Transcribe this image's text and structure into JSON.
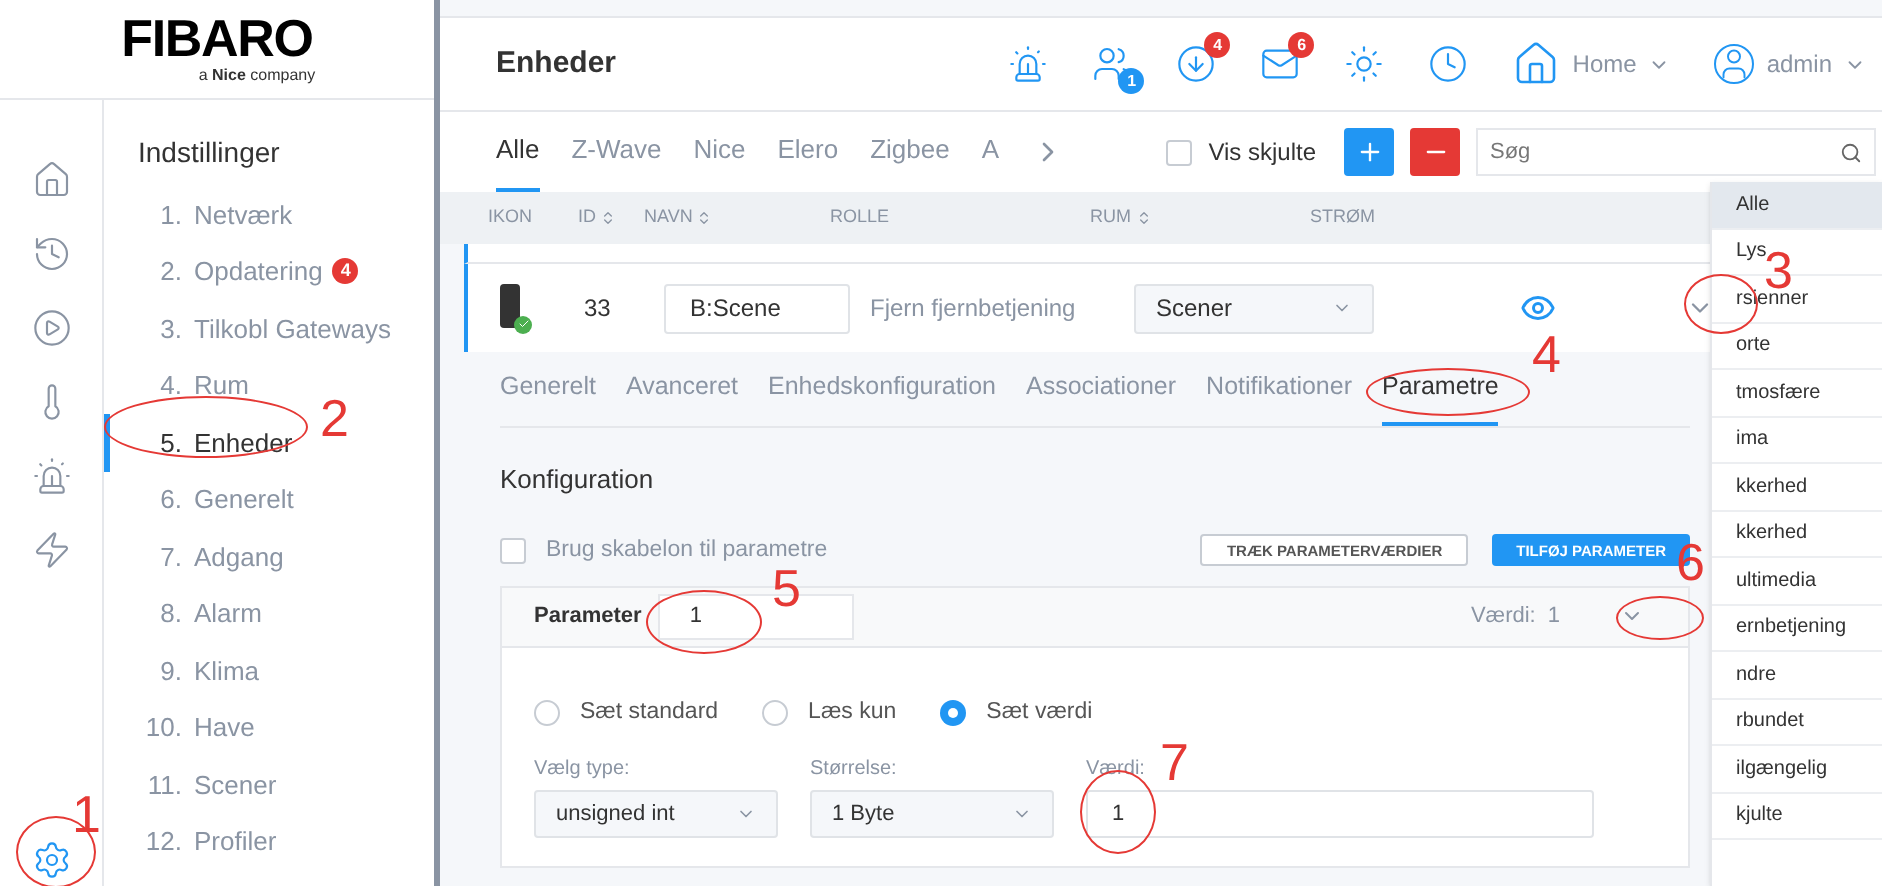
{
  "logo": {
    "brand": "FIBARO",
    "tagline": "a **Nice** company"
  },
  "rail": [
    {
      "kind": "home",
      "selected": false
    },
    {
      "kind": "history",
      "selected": false
    },
    {
      "kind": "play",
      "selected": false
    },
    {
      "kind": "thermometer",
      "selected": false
    },
    {
      "kind": "alarm",
      "selected": false
    },
    {
      "kind": "bolt",
      "selected": false
    },
    {
      "kind": "settings",
      "selected": true
    }
  ],
  "nav": {
    "title": "Indstillinger",
    "items": [
      {
        "number": "1.",
        "label": "Netværk",
        "selected": false
      },
      {
        "number": "2.",
        "label": "Opdatering",
        "selected": false,
        "badge": "4"
      },
      {
        "number": "3.",
        "label": "Tilkobl Gateways",
        "selected": false
      },
      {
        "number": "4.",
        "label": "Rum",
        "selected": false
      },
      {
        "number": "5.",
        "label": "Enheder",
        "selected": true
      },
      {
        "number": "6.",
        "label": "Generelt",
        "selected": false
      },
      {
        "number": "7.",
        "label": "Adgang",
        "selected": false
      },
      {
        "number": "8.",
        "label": "Alarm",
        "selected": false
      },
      {
        "number": "9.",
        "label": "Klima",
        "selected": false
      },
      {
        "number": "10.",
        "label": "Have",
        "selected": false
      },
      {
        "number": "11.",
        "label": "Scener",
        "selected": false
      },
      {
        "number": "12.",
        "label": "Profiler",
        "selected": false
      }
    ]
  },
  "header": {
    "title": "Enheder",
    "icons": [
      {
        "kind": "alarm"
      },
      {
        "kind": "users",
        "badge": "1",
        "color": "#2196f3"
      },
      {
        "kind": "download",
        "badge": "4",
        "color": "#e53935"
      },
      {
        "kind": "mail",
        "badge": "6",
        "color": "#e53935"
      },
      {
        "kind": "sun"
      },
      {
        "kind": "clock"
      }
    ],
    "home": "Home",
    "user": "admin"
  },
  "filter_tabs": [
    {
      "label": "Alle",
      "selected": true
    },
    {
      "label": "Z-Wave",
      "selected": false
    },
    {
      "label": "Nice",
      "selected": false
    },
    {
      "label": "Elero",
      "selected": false
    },
    {
      "label": "Zigbee",
      "selected": false
    },
    {
      "label": "A",
      "selected": false
    }
  ],
  "show_hidden": {
    "label": "Vis skjulte",
    "checked": false
  },
  "search": {
    "placeholder": "Søg"
  },
  "table": {
    "columns": [
      {
        "label": "IKON",
        "sortable": false
      },
      {
        "label": "ID",
        "sortable": true
      },
      {
        "label": "NAVN",
        "sortable": true
      },
      {
        "label": "ROLLE",
        "sortable": false
      },
      {
        "label": "RUM",
        "sortable": true
      },
      {
        "label": "STRØM",
        "sortable": false
      }
    ],
    "row": {
      "id": "33",
      "name": "B:Scene",
      "role": "Fjern fjernbetjening",
      "room": "Scener",
      "expanded": true
    }
  },
  "sub_tabs": [
    {
      "label": "Generelt",
      "selected": false
    },
    {
      "label": "Avanceret",
      "selected": false
    },
    {
      "label": "Enhedskonfiguration",
      "selected": false
    },
    {
      "label": "Associationer",
      "selected": false
    },
    {
      "label": "Notifikationer",
      "selected": false
    },
    {
      "label": "Parametre",
      "selected": true
    }
  ],
  "config": {
    "title": "Konfiguration",
    "template": {
      "label": "Brug skabelon til parametre",
      "checked": false
    },
    "buttons": [
      {
        "label": "TRÆK PARAMETERVÆRDIER",
        "kind": "secondary"
      },
      {
        "label": "TILFØJ PARAMETER",
        "kind": "primary"
      }
    ]
  },
  "parameter": {
    "label": "Parameter",
    "value": "1",
    "value_label": "Værdi:",
    "value_text": "1",
    "expanded": true,
    "radios": [
      {
        "label": "Sæt standard",
        "selected": false
      },
      {
        "label": "Læs kun",
        "selected": false
      },
      {
        "label": "Sæt værdi",
        "selected": true
      }
    ],
    "fields": [
      {
        "kind": "select",
        "label": "Vælg type:",
        "value": "unsigned int"
      },
      {
        "kind": "select",
        "label": "Størrelse:",
        "value": "1 Byte"
      },
      {
        "kind": "input",
        "label": "Værdi:",
        "value": "1"
      }
    ]
  },
  "room_dropdown": {
    "items": [
      {
        "label": "Alle",
        "selected": true
      },
      {
        "label": "Lys",
        "selected": false
      },
      {
        "label": "rsienner",
        "selected": false
      },
      {
        "label": "orte",
        "selected": false
      },
      {
        "label": "tmosfære",
        "selected": false
      },
      {
        "label": "ima",
        "selected": false
      },
      {
        "label": "kkerhed",
        "selected": false
      },
      {
        "label": "kkerhed",
        "selected": false
      },
      {
        "label": "ultimedia",
        "selected": false
      },
      {
        "label": "ernbetjening",
        "selected": false
      },
      {
        "label": "ndre",
        "selected": false
      },
      {
        "label": "rbundet",
        "selected": false
      },
      {
        "label": "ilgængelig",
        "selected": false
      },
      {
        "label": "kjulte",
        "selected": false
      }
    ]
  },
  "annotations": [
    "1",
    "2",
    "3",
    "4",
    "5",
    "6",
    "7"
  ]
}
